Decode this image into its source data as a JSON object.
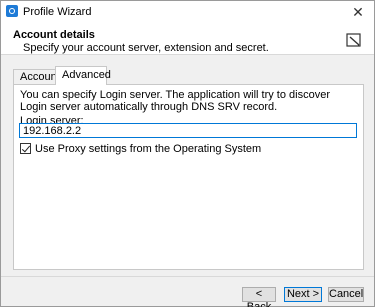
{
  "window": {
    "title": "Profile Wizard",
    "close_glyph": "✕"
  },
  "header": {
    "title": "Account details",
    "subtitle": "Specify your account server, extension and secret.",
    "icon": "edit-form-icon"
  },
  "tabs": [
    {
      "label": "Account",
      "active": false
    },
    {
      "label": "Advanced",
      "active": true
    }
  ],
  "panel": {
    "description": "You can specify Login server. The application will try to discover Login server automatically through DNS SRV record.",
    "server_label": "Login server:",
    "server_value": "192.168.2.2",
    "proxy_checked": true,
    "proxy_label": "Use Proxy settings from the Operating System"
  },
  "footer": {
    "back_label": "< Back",
    "next_label": "Next >",
    "cancel_label": "Cancel"
  },
  "colors": {
    "accent": "#0078d7",
    "app_icon": "#1e7bd7"
  }
}
